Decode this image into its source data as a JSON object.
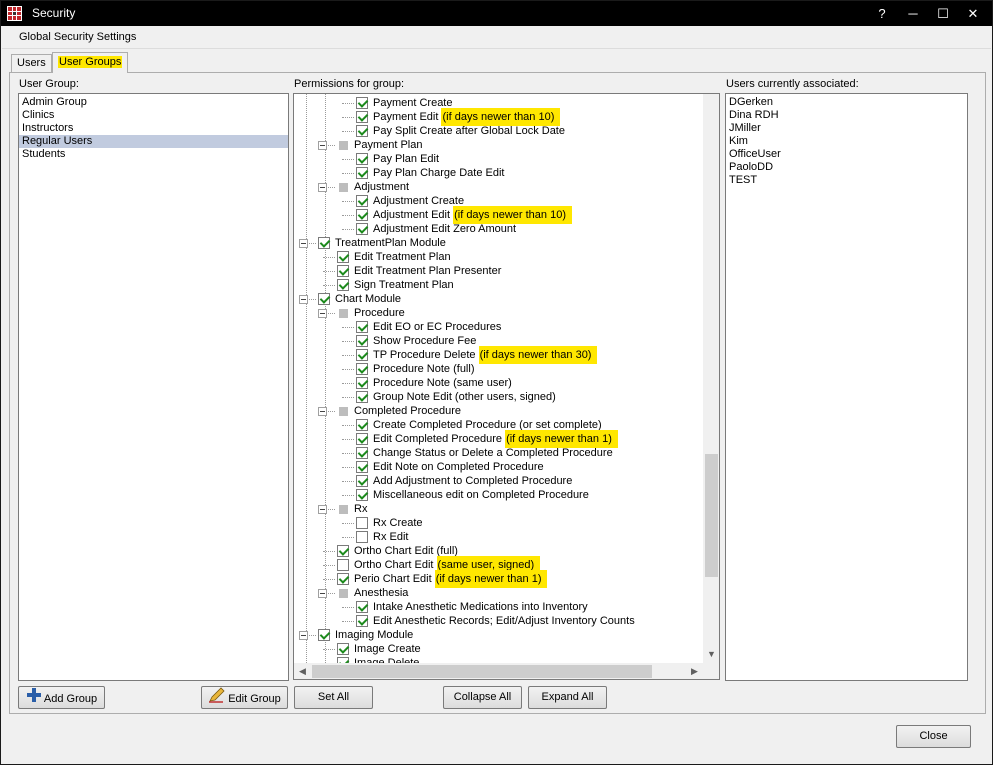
{
  "window": {
    "title": "Security",
    "help": "?",
    "minimize": "─",
    "maximize": "☐",
    "close": "✕"
  },
  "menu": {
    "global_security_settings": "Global Security Settings"
  },
  "tabs": {
    "users": "Users",
    "user_groups": "User Groups"
  },
  "user_group": {
    "label": "User Group:",
    "items": [
      "Admin Group",
      "Clinics",
      "Instructors",
      "Regular Users",
      "Students"
    ],
    "selected": "Regular Users"
  },
  "permissions": {
    "label": "Permissions for group:",
    "rows": [
      {
        "text": "Payment Create",
        "note": "",
        "checked": true
      },
      {
        "text": "Payment Edit ",
        "note": "(if days newer than 10)",
        "checked": true
      },
      {
        "text": "Pay Split Create after Global Lock Date",
        "note": "",
        "checked": true
      },
      {
        "text": "Payment Plan",
        "note": "",
        "checked": "partial"
      },
      {
        "text": "Pay Plan Edit",
        "note": "",
        "checked": true
      },
      {
        "text": "Pay Plan Charge Date Edit",
        "note": "",
        "checked": true
      },
      {
        "text": "Adjustment",
        "note": "",
        "checked": "partial"
      },
      {
        "text": "Adjustment Create",
        "note": "",
        "checked": true
      },
      {
        "text": "Adjustment Edit ",
        "note": "(if days newer than 10)",
        "checked": true
      },
      {
        "text": "Adjustment Edit Zero Amount",
        "note": "",
        "checked": true
      },
      {
        "text": "TreatmentPlan Module",
        "note": "",
        "checked": true
      },
      {
        "text": "Edit Treatment Plan",
        "note": "",
        "checked": true
      },
      {
        "text": "Edit Treatment Plan Presenter",
        "note": "",
        "checked": true
      },
      {
        "text": "Sign Treatment Plan",
        "note": "",
        "checked": true
      },
      {
        "text": "Chart Module",
        "note": "",
        "checked": true
      },
      {
        "text": "Procedure",
        "note": "",
        "checked": "partial"
      },
      {
        "text": "Edit EO or EC Procedures",
        "note": "",
        "checked": true
      },
      {
        "text": "Show Procedure Fee",
        "note": "",
        "checked": true
      },
      {
        "text": "TP Procedure Delete ",
        "note": "(if days newer than 30)",
        "checked": true
      },
      {
        "text": "Procedure Note (full)",
        "note": "",
        "checked": true
      },
      {
        "text": "Procedure Note (same user)",
        "note": "",
        "checked": true
      },
      {
        "text": "Group Note Edit (other users, signed)",
        "note": "",
        "checked": true
      },
      {
        "text": "Completed Procedure",
        "note": "",
        "checked": "partial"
      },
      {
        "text": "Create Completed Procedure (or set complete)",
        "note": "",
        "checked": true
      },
      {
        "text": "Edit Completed Procedure ",
        "note": "(if days newer than 1)",
        "checked": true
      },
      {
        "text": "Change Status or Delete a Completed Procedure",
        "note": "",
        "checked": true
      },
      {
        "text": "Edit Note on Completed Procedure",
        "note": "",
        "checked": true
      },
      {
        "text": "Add Adjustment to Completed Procedure",
        "note": "",
        "checked": true
      },
      {
        "text": "Miscellaneous edit on Completed Procedure",
        "note": "",
        "checked": true
      },
      {
        "text": "Rx",
        "note": "",
        "checked": "partial"
      },
      {
        "text": "Rx Create",
        "note": "",
        "checked": false
      },
      {
        "text": "Rx Edit",
        "note": "",
        "checked": false
      },
      {
        "text": "Ortho Chart Edit (full)",
        "note": "",
        "checked": true
      },
      {
        "text": "Ortho Chart Edit ",
        "note": "(same user, signed)",
        "checked": false
      },
      {
        "text": "Perio Chart Edit ",
        "note": "(if days newer than 1)",
        "checked": true
      },
      {
        "text": "Anesthesia",
        "note": "",
        "checked": "partial"
      },
      {
        "text": "Intake Anesthetic Medications into Inventory",
        "note": "",
        "checked": true
      },
      {
        "text": "Edit Anesthetic Records; Edit/Adjust Inventory Counts",
        "note": "",
        "checked": true
      },
      {
        "text": "Imaging Module",
        "note": "",
        "checked": true
      },
      {
        "text": "Image Create",
        "note": "",
        "checked": true
      },
      {
        "text": "Image Delete",
        "note": "",
        "checked": true
      }
    ]
  },
  "users_associated": {
    "label": "Users currently associated:",
    "items": [
      "DGerken",
      "Dina RDH",
      "JMiller",
      "Kim",
      "OfficeUser",
      "PaoloDD",
      "TEST"
    ]
  },
  "buttons": {
    "add_group": "Add Group",
    "edit_group": "Edit Group",
    "set_all": "Set All",
    "collapse_all": "Collapse All",
    "expand_all": "Expand All",
    "close": "Close"
  }
}
